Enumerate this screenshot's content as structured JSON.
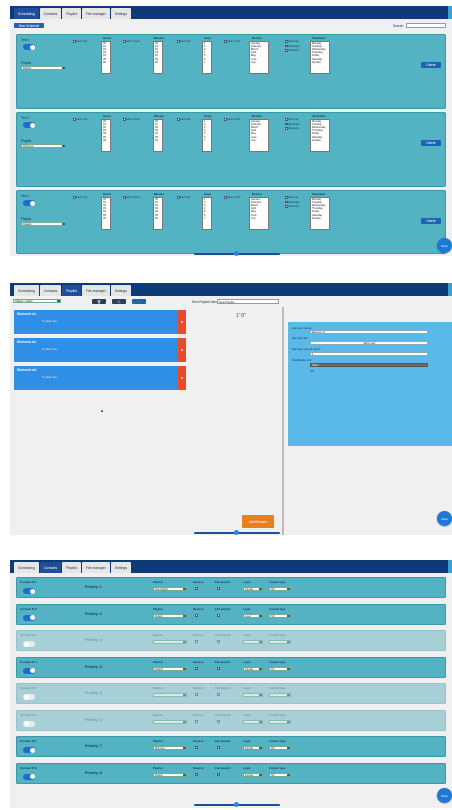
{
  "tabs_a": [
    "Scheduling",
    "Contacts",
    "Playlist",
    "File manager",
    "Settings"
  ],
  "tabs_b": [
    "Scheduling",
    "Contacts",
    "Playlist",
    "File manager",
    "Settings"
  ],
  "tabs_c": [
    "Scheduling",
    "Contacts",
    "Playlist",
    "File manager",
    "Settings"
  ],
  "scheduling": {
    "new_btn": "New Schedule",
    "search_label": "Search:",
    "col_hours": "Hour/s",
    "col_minutes": "Minute/s",
    "col_days": "Day/s",
    "col_months": "Month/s",
    "col_weekdays": "Weekday/s",
    "each_hour": "Each hour",
    "each_minute": "Each minute",
    "each_day": "Each day",
    "each_month": "Each month",
    "each_day_w": "Each day",
    "weekdays": "Weekdays",
    "weekend": "Weekend",
    "playlist_label": "Playlist",
    "delete": "Delete",
    "save": "Save",
    "hours_list": "00\n01\n02\n03\n04\n05\n06",
    "minutes_list": "00\n01\n02\n03\n04\n05\n06",
    "days_list": "1\n2\n3\n4\n5\n6\n7",
    "months_list": "January\nFebruary\nMarch\nApril\nMay\nJune\nJuly",
    "weekdays_list": "Monday\nTuesday\nWednesday\nThursday\nFriday\nSaturday\nSunday",
    "tests": [
      {
        "name": "Test 0",
        "playlist": "Default"
      },
      {
        "name": "Test 2",
        "playlist": "Welcome"
      },
      {
        "name": "Test 1",
        "playlist": "Default"
      }
    ]
  },
  "playlist": {
    "select_value": "Default - Attach",
    "name_label": "New Playlist Name:",
    "name_value": "New Playlist",
    "duration": "1' 0\"",
    "elements": [
      {
        "title": "Element n1",
        "sub": "To alarm.wav"
      },
      {
        "title": "Element n2",
        "sub": "To alarm.wav"
      },
      {
        "title": "Element n3",
        "sub": "To alarm.wav"
      }
    ],
    "add_btn": "Add Element",
    "props": {
      "name_label": "Element name:",
      "name_value": "Element n1",
      "file_label": "Element file:",
      "file_value": "alarm.wav",
      "repeat_label": "Element repeat times:",
      "repeat_value": "1",
      "webradio_label": "WebRadio link:",
      "opt1": "http://",
      "opt2": "Off"
    },
    "save": "Save"
  },
  "contacts": {
    "playlist_label": "Playlist:",
    "reverse_label": "Reverse:",
    "end_label": "End playlist:",
    "logic_label": "Logic:",
    "type_label": "Contact type:",
    "save": "Save",
    "rows": [
      {
        "name": "Contact N 1",
        "priority": "Priority: 1",
        "playlist": "New Playlist",
        "logic": "Impulse",
        "type": "NO",
        "on": true
      },
      {
        "name": "Contact N 2",
        "priority": "Priority: 2",
        "playlist": "Default",
        "logic": "Level",
        "type": "NO",
        "on": true
      },
      {
        "name": "Contact N 3",
        "priority": "Priority: 3",
        "playlist": "",
        "logic": "",
        "type": "",
        "on": false
      },
      {
        "name": "Contact N 4",
        "priority": "Priority: 4",
        "playlist": "Default",
        "logic": "Impulse",
        "type": "NC",
        "on": true
      },
      {
        "name": "Contact N 5",
        "priority": "Priority: 5",
        "playlist": "",
        "logic": "",
        "type": "",
        "on": false
      },
      {
        "name": "Contact N 6",
        "priority": "Priority: 6",
        "playlist": "",
        "logic": "",
        "type": "",
        "on": false
      },
      {
        "name": "Contact N 7",
        "priority": "Priority: 7",
        "playlist": "Welcome",
        "logic": "Impulse",
        "type": "NO",
        "on": true
      },
      {
        "name": "Contact N 8",
        "priority": "Priority: 8",
        "playlist": "Default",
        "logic": "Impulse",
        "type": "NO",
        "on": true
      }
    ]
  },
  "colors": {
    "nav": "#0f3a78",
    "card": "#53b3c2",
    "accent": "#1d63b4",
    "danger": "#e84a2a"
  }
}
